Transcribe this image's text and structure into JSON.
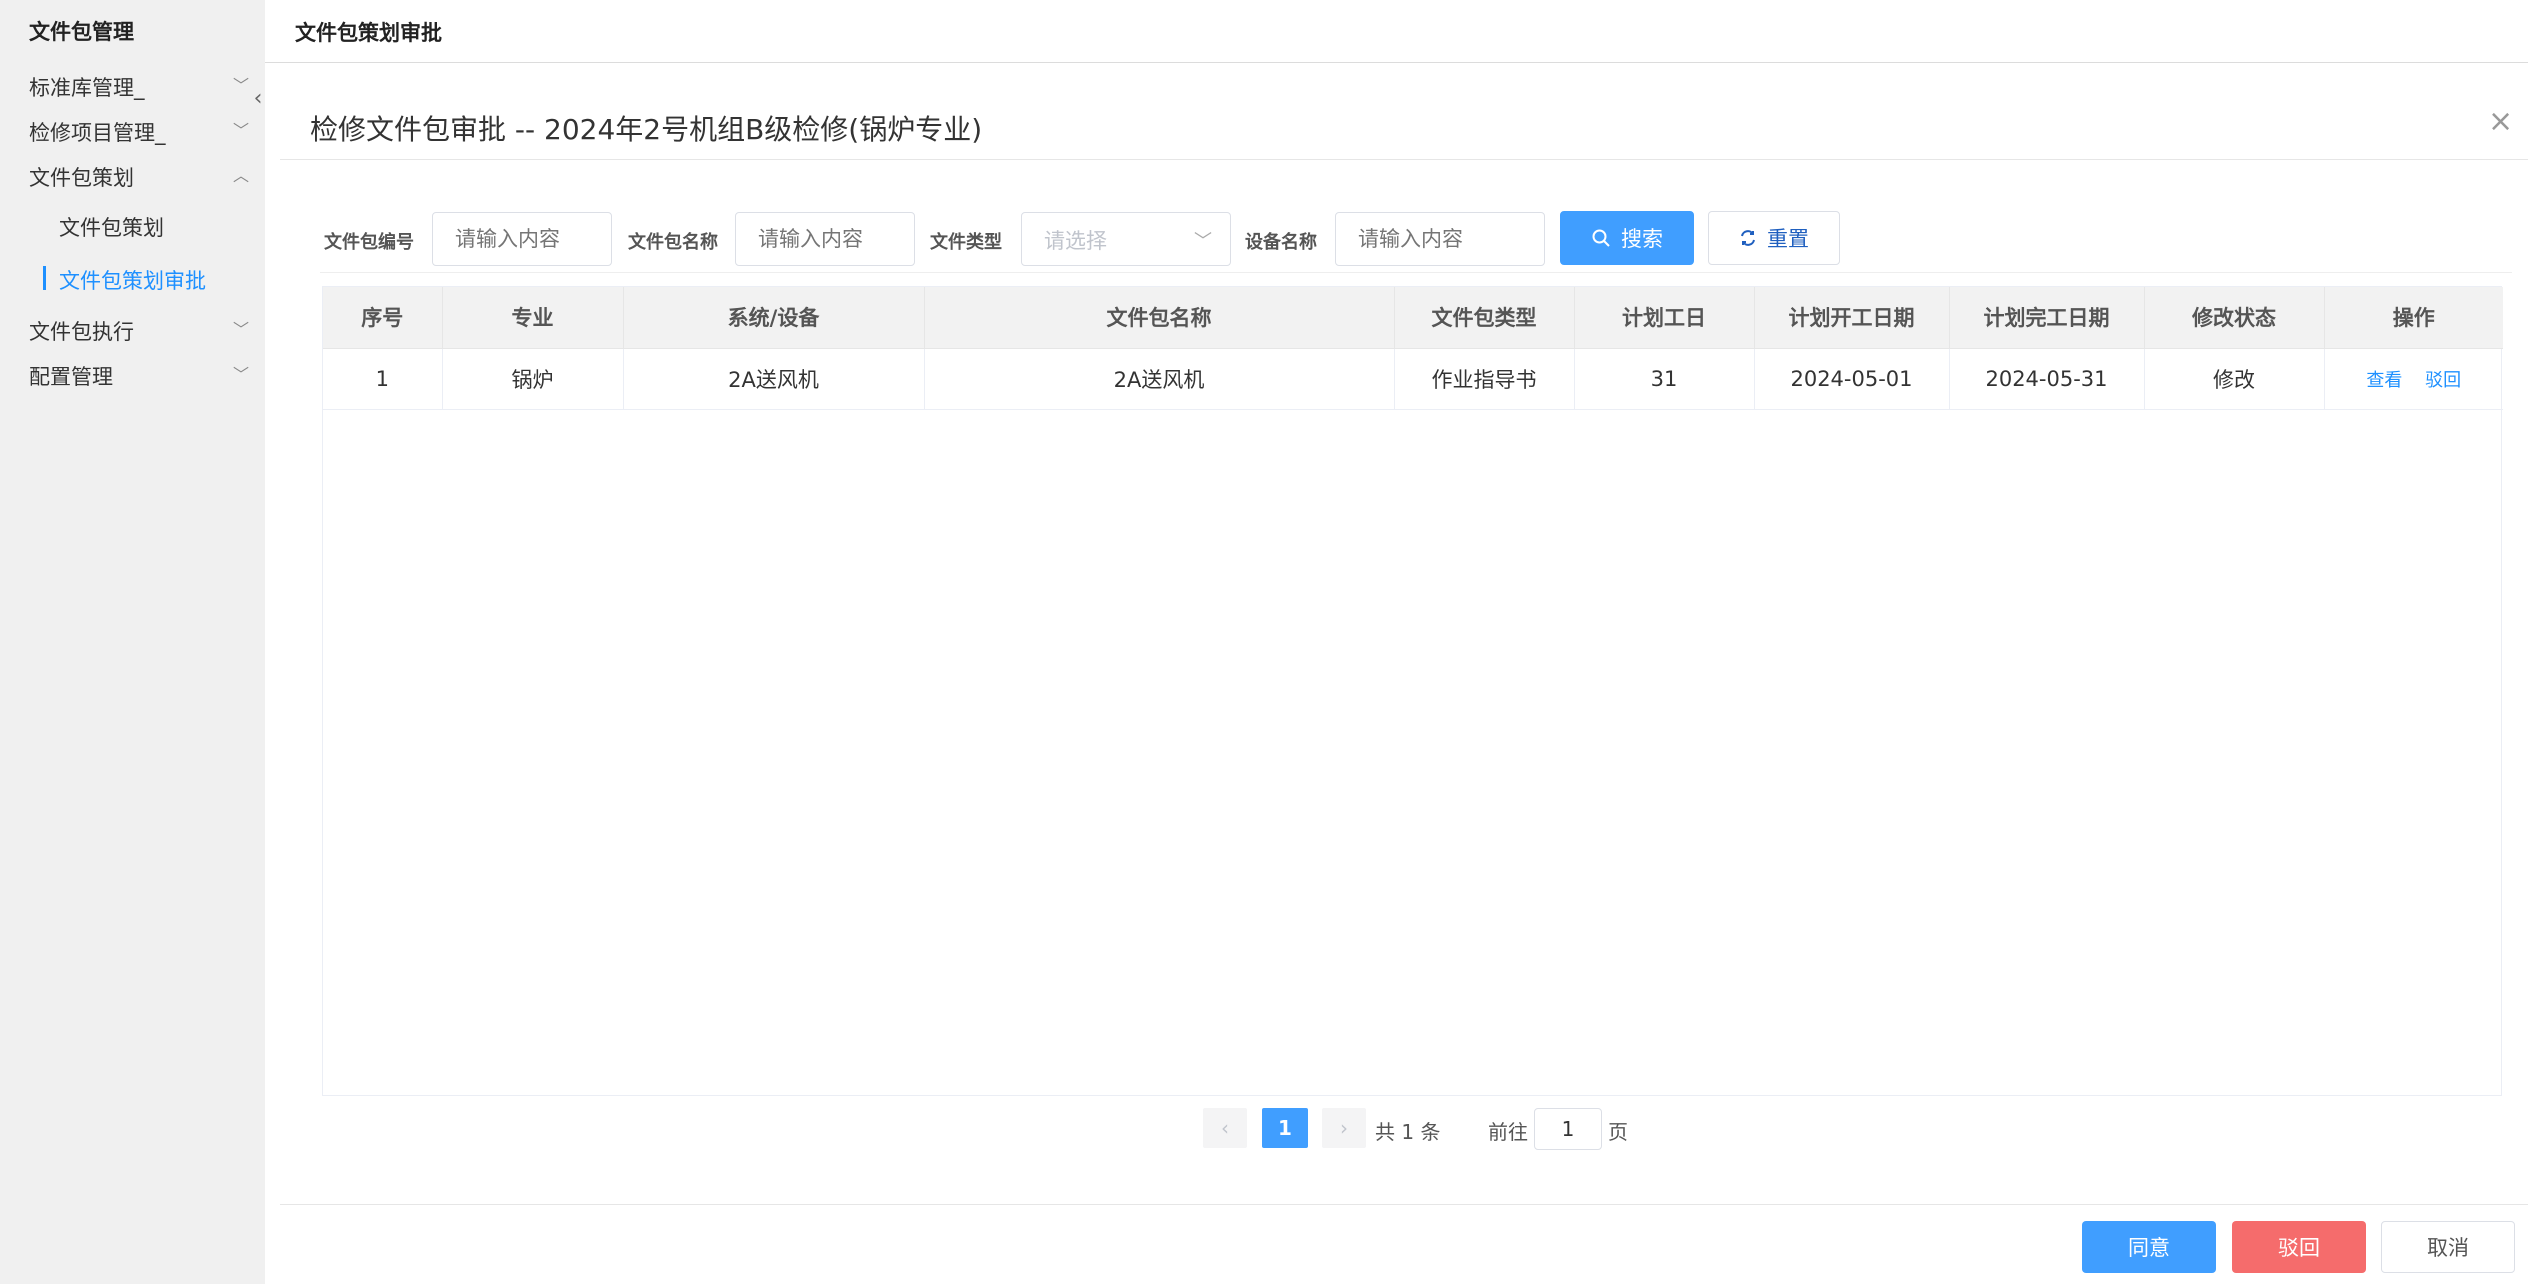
{
  "sidebar": {
    "title": "文件包管理",
    "collapse_icon": "chevron-left-icon",
    "items": [
      {
        "label": "标准库管理_",
        "chevron": "﹀"
      },
      {
        "label": "检修项目管理_",
        "chevron": "﹀"
      },
      {
        "label": "文件包策划",
        "chevron": "︿"
      },
      {
        "label": "文件包执行",
        "chevron": "﹀"
      },
      {
        "label": "配置管理",
        "chevron": "﹀"
      }
    ],
    "sub_items": [
      {
        "label": "文件包策划"
      },
      {
        "label": "文件包策划审批"
      }
    ]
  },
  "header": {
    "title": "文件包策划审批"
  },
  "dialog": {
    "title": "检修文件包审批 -- 2024年2号机组B级检修(锅炉专业)",
    "close": "×"
  },
  "filters": {
    "pkg_no_label": "文件包编号",
    "pkg_no_placeholder": "请输入内容",
    "pkg_name_label": "文件包名称",
    "pkg_name_placeholder": "请输入内容",
    "file_type_label": "文件类型",
    "file_type_placeholder": "请选择",
    "device_label": "设备名称",
    "device_placeholder": "请输入内容",
    "search_label": "搜索",
    "reset_label": "重置"
  },
  "table": {
    "columns": [
      "序号",
      "专业",
      "系统/设备",
      "文件包名称",
      "文件包类型",
      "计划工日",
      "计划开工日期",
      "计划完工日期",
      "修改状态",
      "操作"
    ],
    "rows": [
      {
        "no": "1",
        "major": "锅炉",
        "system": "2A送风机",
        "pkg_name": "2A送风机",
        "pkg_type": "作业指导书",
        "days": "31",
        "start": "2024-05-01",
        "end": "2024-05-31",
        "status": "修改",
        "view": "查看",
        "reject": "驳回"
      }
    ]
  },
  "pagination": {
    "prev": "‹",
    "current": "1",
    "next": "›",
    "total": "共 1 条",
    "goto_prefix": "前往",
    "goto_value": "1",
    "goto_suffix": "页"
  },
  "footer": {
    "agree": "同意",
    "reject": "驳回",
    "cancel": "取消"
  },
  "colors": {
    "primary": "#409eff",
    "danger": "#f56c6c",
    "link": "#1e90ff"
  }
}
